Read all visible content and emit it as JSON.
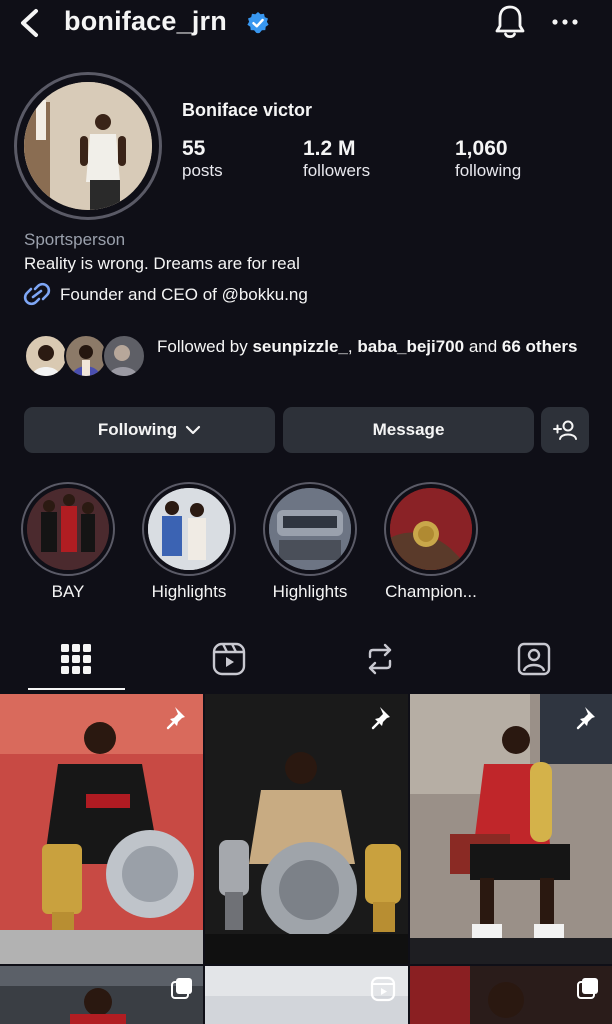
{
  "header": {
    "username": "boniface_jrn",
    "icons": [
      "back-icon",
      "verified-icon",
      "bell-icon",
      "more-icon"
    ]
  },
  "profile": {
    "display_name": "Boniface victor",
    "stats": {
      "posts_count": "55",
      "posts_label": "posts",
      "followers_count": "1.2 M",
      "followers_label": "followers",
      "following_count": "1,060",
      "following_label": "following"
    },
    "category": "Sportsperson",
    "bio": "Reality is wrong. Dreams are for real",
    "link_text": "Founder and CEO of @bokku.ng"
  },
  "followed_by": {
    "prefix": "Followed by ",
    "user1": "seunpizzle_",
    "sep": ", ",
    "user2": "baba_beji700",
    "and_text": " and ",
    "others": "66 others"
  },
  "actions": {
    "following_label": "Following",
    "message_label": "Message"
  },
  "highlights": [
    {
      "label": "BAY"
    },
    {
      "label": "Highlights"
    },
    {
      "label": "Highlights"
    },
    {
      "label": "Champion..."
    }
  ],
  "tabs": [
    "grid-icon",
    "reels-icon",
    "reposts-icon",
    "tagged-icon"
  ],
  "colors": {
    "background": "#0f0f17",
    "button": "#2d3139",
    "verified": "#3897f0",
    "secondary_text": "#9aa0ac"
  }
}
